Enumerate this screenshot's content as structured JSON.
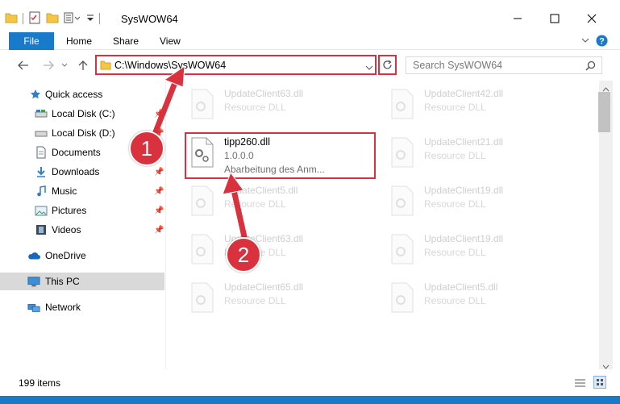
{
  "window": {
    "title": "SysWOW64"
  },
  "ribbon": {
    "tabs": [
      "File",
      "Home",
      "Share",
      "View"
    ]
  },
  "address": {
    "path": "C:\\Windows\\SysWOW64"
  },
  "search": {
    "placeholder": "Search SysWOW64"
  },
  "nav": {
    "items": [
      {
        "label": "Quick access",
        "icon": "star-icon",
        "pinned": false
      },
      {
        "label": "Local Disk (C:)",
        "icon": "drive-icon",
        "pinned": true
      },
      {
        "label": "Local Disk (D:)",
        "icon": "drive-icon",
        "pinned": true
      },
      {
        "label": "Documents",
        "icon": "documents-icon",
        "pinned": true
      },
      {
        "label": "Downloads",
        "icon": "download-icon",
        "pinned": true
      },
      {
        "label": "Music",
        "icon": "music-icon",
        "pinned": true
      },
      {
        "label": "Pictures",
        "icon": "pictures-icon",
        "pinned": true
      },
      {
        "label": "Videos",
        "icon": "videos-icon",
        "pinned": true
      },
      {
        "label": "OneDrive",
        "icon": "cloud-icon",
        "pinned": false
      },
      {
        "label": "This PC",
        "icon": "computer-icon",
        "pinned": false
      },
      {
        "label": "Network",
        "icon": "network-icon",
        "pinned": false
      }
    ]
  },
  "files": [
    {
      "name": "UpdateClient63.dll",
      "desc": "Resource DLL"
    },
    {
      "name": "UpdateClient42.dll",
      "desc": "Resource DLL"
    },
    {
      "name": "tipp260.dll",
      "desc": "1.0.0.0",
      "desc2": "Abarbeitung des Anm..."
    },
    {
      "name": "UpdateClient21.dll",
      "desc": "Resource DLL"
    },
    {
      "name": "UpdateClient5.dll",
      "desc": "Resource DLL"
    },
    {
      "name": "UpdateClient19.dll",
      "desc": "Resource DLL"
    },
    {
      "name": "UpdateClient63.dll",
      "desc": "Resource DLL"
    },
    {
      "name": "UpdateClient19.dll",
      "desc": "Resource DLL"
    },
    {
      "name": "UpdateClient65.dll",
      "desc": "Resource DLL"
    },
    {
      "name": "UpdateClient5.dll",
      "desc": "Resource DLL"
    }
  ],
  "status": {
    "item_count": "199 items"
  },
  "annotations": {
    "step1": "1",
    "step2": "2"
  },
  "colors": {
    "accent": "#1979ca",
    "highlight": "#d9323e",
    "selection": "#d9d9d9"
  }
}
